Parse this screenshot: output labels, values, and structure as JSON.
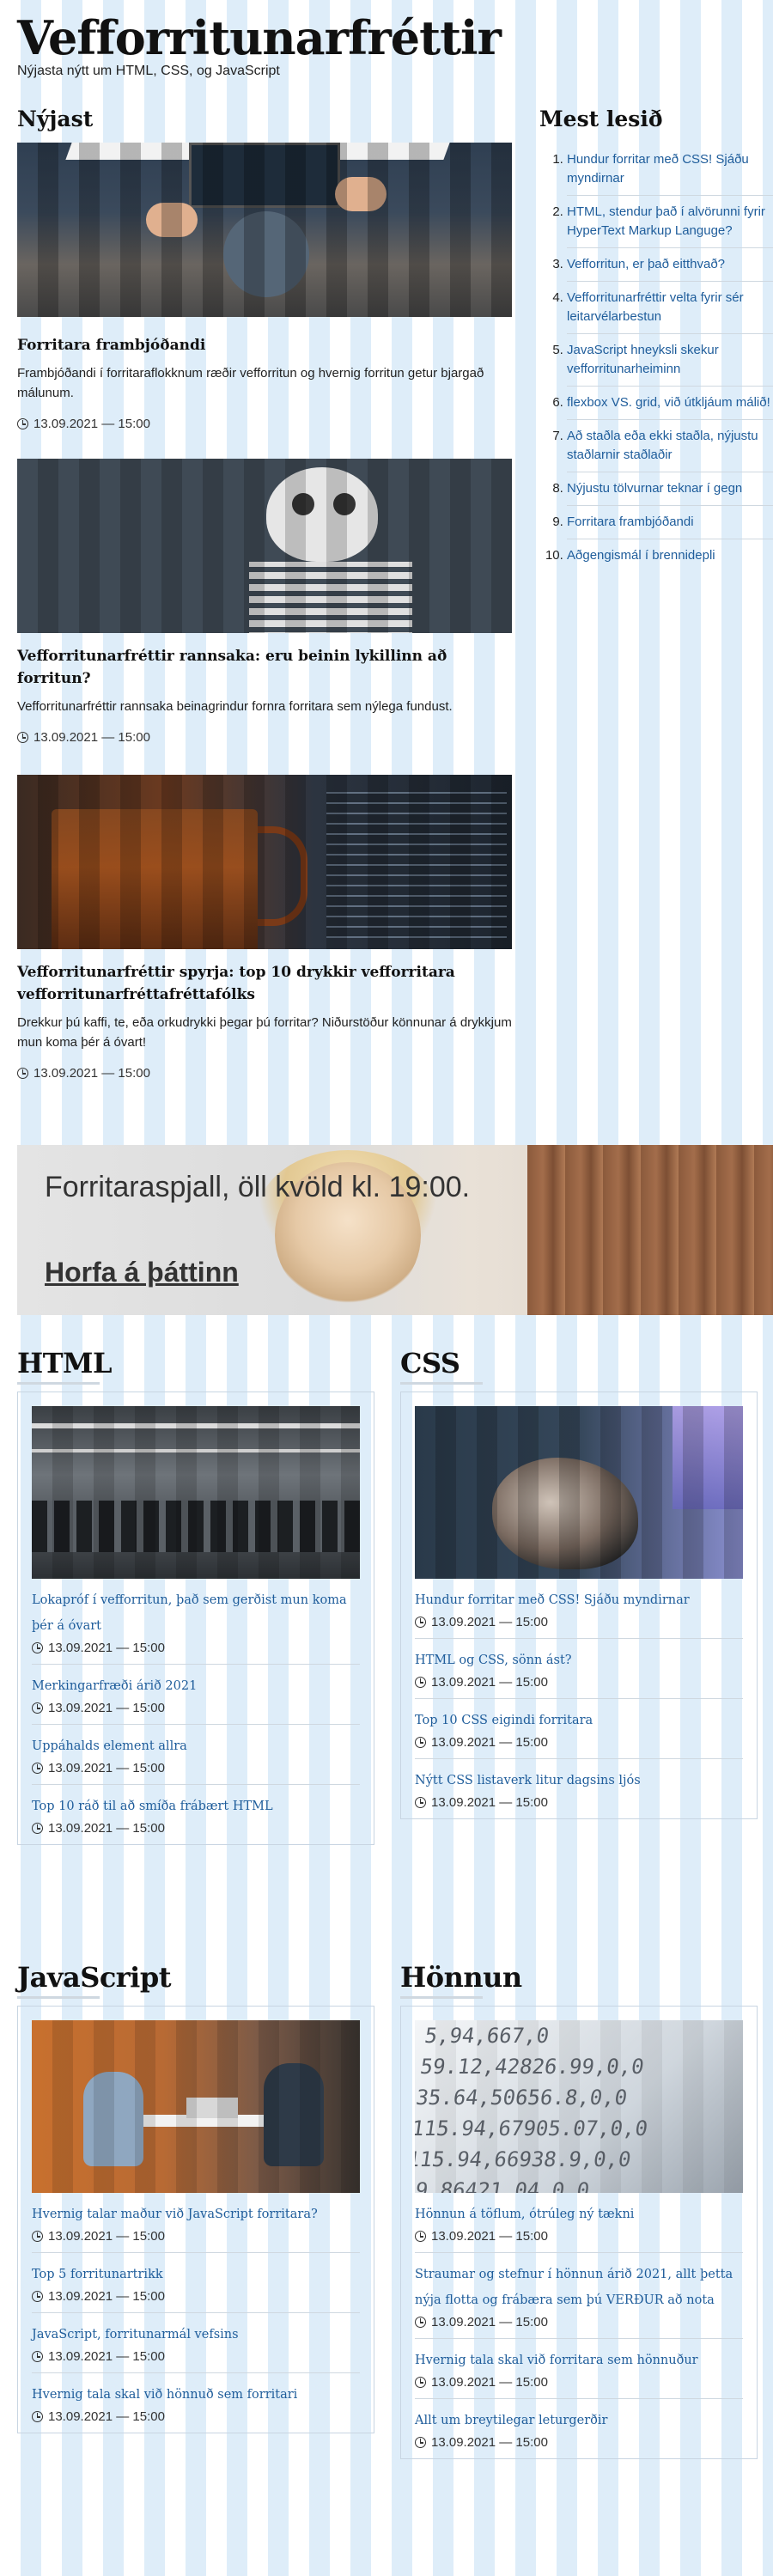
{
  "site": {
    "title": "Vefforritunarfréttir",
    "subtitle": "Nýjasta nýtt um HTML, CSS, og JavaScript"
  },
  "latest": {
    "heading": "Nýjast",
    "stories": [
      {
        "title": "Forritara frambjóðandi",
        "summary": "Frambjóðandi í forritaraflokknum ræðir vefforritun og hvernig forritun getur bjargað málunum.",
        "date": "13.09.2021 — 15:00"
      },
      {
        "title": "Vefforritunarfréttir rannsaka: eru beinin lykillinn að forritun?",
        "summary": "Vefforritunarfréttir rannsaka beinagrindur fornra forritara sem nýlega fundust.",
        "date": "13.09.2021 — 15:00"
      },
      {
        "title": "Vefforritunarfréttir spyrja: top 10 drykkir vefforritara vefforritunarfréttafréttafólks",
        "summary": "Drekkur þú kaffi, te, eða orkudrykki þegar þú forritar? Niðurstöður könnunar á drykkjum mun koma þér á óvart!",
        "date": "13.09.2021 — 15:00"
      }
    ]
  },
  "popular": {
    "heading": "Mest lesið",
    "items": [
      "Hundur forritar með CSS! Sjáðu myndirnar",
      "HTML, stendur það í alvörunni fyrir HyperText Markup Languge?",
      "Vefforritun, er það eitthvað?",
      "Vefforritunarfréttir velta fyrir sér leitarvélarbestun",
      "JavaScript hneyksli skekur vefforritunarheiminn",
      "flexbox VS. grid, við útkljáum málið!",
      "Að staðla eða ekki staðla, nýjustu staðlarnir staðlaðir",
      "Nýjustu tölvurnar teknar í gegn",
      "Forritara frambjóðandi",
      "Aðgengismál í brennidepli"
    ]
  },
  "promo": {
    "text": "Forritaraspjall, öll kvöld kl. 19:00.",
    "link": "Horfa á þáttinn"
  },
  "categories": {
    "html": {
      "heading": "HTML",
      "items": [
        {
          "title": "Lokapróf í vefforritun, það sem gerðist mun koma þér á óvart",
          "date": "13.09.2021 — 15:00"
        },
        {
          "title": "Merkingarfræði árið 2021",
          "date": "13.09.2021 — 15:00"
        },
        {
          "title": "Uppáhalds element allra",
          "date": "13.09.2021 — 15:00"
        },
        {
          "title": "Top 10 ráð til að smíða frábært HTML",
          "date": "13.09.2021 — 15:00"
        }
      ]
    },
    "css": {
      "heading": "CSS",
      "items": [
        {
          "title": "Hundur forritar með CSS! Sjáðu myndirnar",
          "date": "13.09.2021 — 15:00"
        },
        {
          "title": "HTML og CSS, sönn ást?",
          "date": "13.09.2021 — 15:00"
        },
        {
          "title": "Top 10 CSS eigindi forritara",
          "date": "13.09.2021 — 15:00"
        },
        {
          "title": "Nýtt CSS listaverk litur dagsins ljós",
          "date": "13.09.2021 — 15:00"
        }
      ]
    },
    "javascript": {
      "heading": "JavaScript",
      "items": [
        {
          "title": "Hvernig talar maður við JavaScript forritara?",
          "date": "13.09.2021 — 15:00"
        },
        {
          "title": "Top 5 forritunartrikk",
          "date": "13.09.2021 — 15:00"
        },
        {
          "title": "JavaScript, forritunarmál vefsins",
          "date": "13.09.2021 — 15:00"
        },
        {
          "title": "Hvernig tala skal við hönnuð sem forritari",
          "date": "13.09.2021 — 15:00"
        }
      ]
    },
    "design": {
      "heading": "Hönnun",
      "items": [
        {
          "title": "Hönnun á töflum, ótrúleg ný tækni",
          "date": "13.09.2021 — 15:00"
        },
        {
          "title": "Straumar og stefnur í hönnun árið 2021, allt þetta nýja flotta og frábæra sem þú VERÐUR að nota",
          "date": "13.09.2021 — 15:00"
        },
        {
          "title": "Hvernig tala skal við forritara sem hönnuður",
          "date": "13.09.2021 — 15:00"
        },
        {
          "title": "Allt um breytilegar leturgerðir",
          "date": "13.09.2021 — 15:00"
        }
      ]
    }
  }
}
